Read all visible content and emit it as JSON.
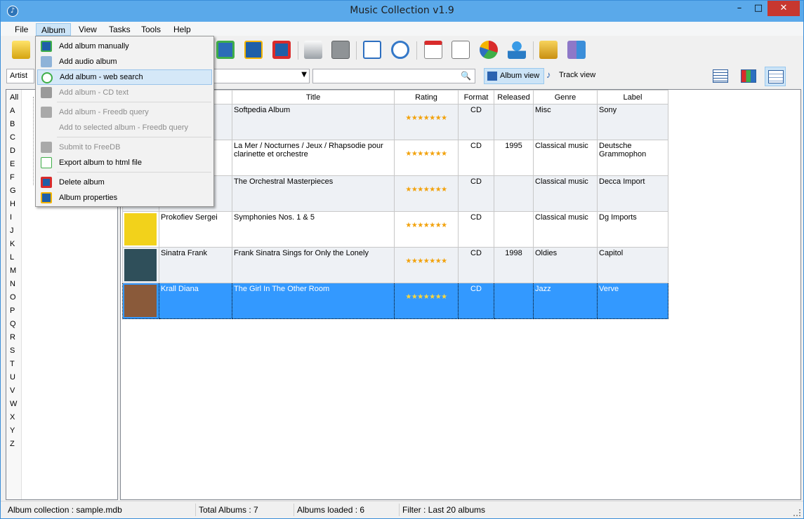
{
  "window": {
    "title": "Music Collection v1.9"
  },
  "menubar": {
    "items": [
      "File",
      "Album",
      "View",
      "Tasks",
      "Tools",
      "Help"
    ]
  },
  "filterbar": {
    "artist_label": "Artist",
    "album_view": "Album view",
    "track_view": "Track view"
  },
  "letters": [
    "All",
    "A",
    "B",
    "C",
    "D",
    "E",
    "F",
    "G",
    "H",
    "I",
    "J",
    "K",
    "L",
    "M",
    "N",
    "O",
    "P",
    "Q",
    "R",
    "S",
    "T",
    "U",
    "V",
    "W",
    "X",
    "Y",
    "Z"
  ],
  "table": {
    "headers": [
      "Title",
      "Rating",
      "Format",
      "Released",
      "Genre",
      "Label"
    ],
    "rows": [
      {
        "artist": "",
        "title": "Softpedia Album",
        "rating": 7,
        "format": "CD",
        "released": "",
        "genre": "Misc",
        "label": "Sony",
        "cover": ""
      },
      {
        "artist": "",
        "title": "La Mer / Nocturnes / Jeux / Rhapsodie pour clarinette et orchestre",
        "rating": 7,
        "format": "CD",
        "released": "1995",
        "genre": "Classical music",
        "label": "Deutsche Grammophon",
        "cover": ""
      },
      {
        "artist": "",
        "title": "The Orchestral Masterpieces",
        "rating": 7,
        "format": "CD",
        "released": "",
        "genre": "Classical music",
        "label": "Decca Import",
        "cover": ""
      },
      {
        "artist": "Prokofiev Sergei",
        "title": "Symphonies Nos. 1 & 5",
        "rating": 7,
        "format": "CD",
        "released": "",
        "genre": "Classical music",
        "label": "Dg Imports",
        "cover": "#f2d21b"
      },
      {
        "artist": "Sinatra Frank",
        "title": "Frank Sinatra Sings for Only the Lonely",
        "rating": 7,
        "format": "CD",
        "released": "1998",
        "genre": "Oldies",
        "label": "Capitol",
        "cover": "#2f4f5a"
      },
      {
        "artist": "Krall Diana",
        "title": "The Girl In The Other Room",
        "rating": 7,
        "format": "CD",
        "released": "",
        "genre": "Jazz",
        "label": "Verve",
        "cover": "#8a5a3a"
      }
    ],
    "rating_max": 7
  },
  "album_menu": {
    "items": [
      {
        "label": "Add album manually",
        "state": "normal"
      },
      {
        "label": "Add audio album",
        "state": "normal"
      },
      {
        "label": "Add album - web search",
        "state": "hover"
      },
      {
        "label": "Add album - CD text",
        "state": "disabled"
      },
      {
        "label": "Add album - Freedb query",
        "state": "disabled"
      },
      {
        "label": "Add to selected album - Freedb query",
        "state": "disabled"
      },
      {
        "label": "Submit to FreeDB",
        "state": "disabled"
      },
      {
        "label": "Export album to html file",
        "state": "normal"
      },
      {
        "label": "Delete album",
        "state": "normal"
      },
      {
        "label": "Album properties",
        "state": "normal"
      }
    ]
  },
  "statusbar": {
    "collection": "Album collection : sample.mdb",
    "total": "Total Albums : 7",
    "loaded": "Albums loaded : 6",
    "filter": "Filter : Last 20 albums"
  },
  "colors": {
    "titlebar": "#5aa9ea",
    "selection": "#3399ff",
    "star": "#f2a20c"
  }
}
